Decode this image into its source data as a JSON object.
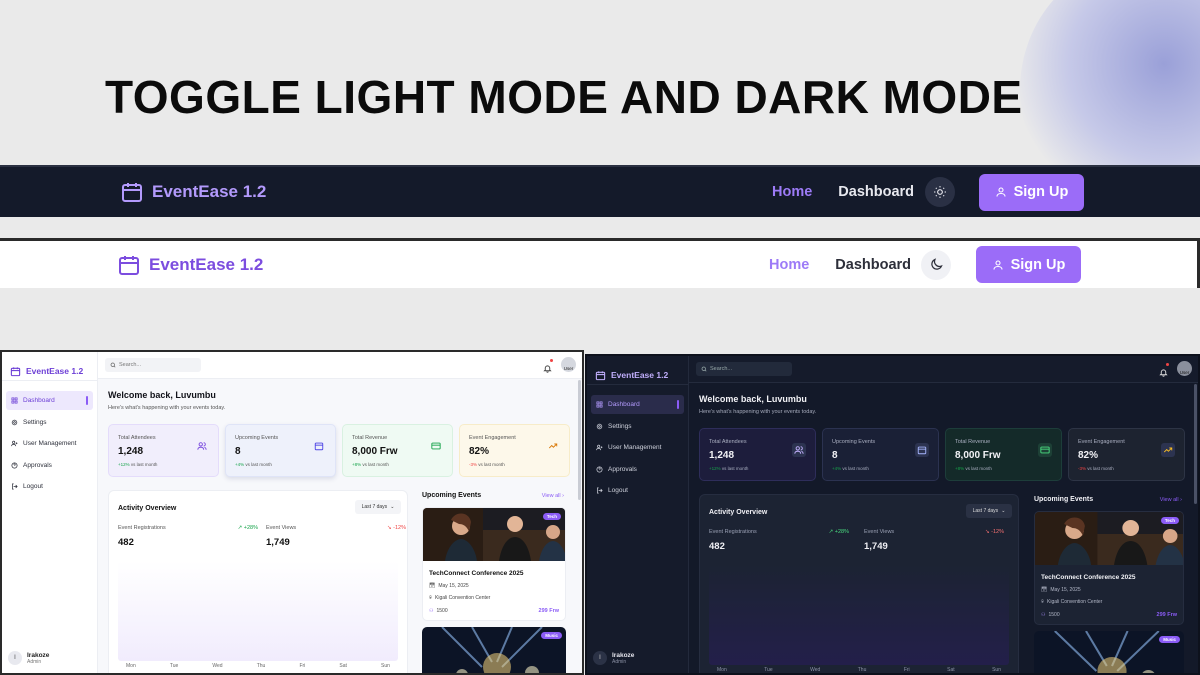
{
  "heading": "TOGGLE LIGHT MODE AND DARK MODE",
  "navbar": {
    "brand": "EventEase 1.2",
    "home": "Home",
    "dashboard": "Dashboard",
    "sign_up": "Sign Up",
    "dark_mode_icon": "sun-icon",
    "light_mode_icon": "moon-icon"
  },
  "dashboard": {
    "brand": "EventEase 1.2",
    "search_placeholder": "Search...",
    "user_avatar": "User",
    "menu": [
      {
        "label": "Dashboard",
        "icon": "grid-icon",
        "active": true
      },
      {
        "label": "Settings",
        "icon": "gear-icon"
      },
      {
        "label": "User Management",
        "icon": "user-plus-icon"
      },
      {
        "label": "Approvals",
        "icon": "question-circle-icon"
      },
      {
        "label": "Logout",
        "icon": "logout-icon"
      }
    ],
    "user": {
      "initial": "I",
      "name": "Irakoze",
      "role": "Admin"
    },
    "welcome": "Welcome back, Luvumbu",
    "subtitle": "Here's what's happening with your events today.",
    "stats": [
      {
        "label": "Total Attendees",
        "value": "1,248",
        "change": "+12%",
        "note": "vs last month",
        "trend": "up"
      },
      {
        "label": "Upcoming Events",
        "value": "8",
        "change": "+4%",
        "note": "vs last month",
        "trend": "up"
      },
      {
        "label": "Total Revenue",
        "value": "8,000 Frw",
        "change": "+8%",
        "note": "vs last month",
        "trend": "up"
      },
      {
        "label": "Event Engagement",
        "value": "82%",
        "change": "-3%",
        "note": "vs last month",
        "trend": "down"
      }
    ],
    "activity": {
      "title": "Activity Overview",
      "range": "Last 7 days",
      "registrations_label": "Event Registrations",
      "registrations_value": "482",
      "registrations_change": "+28%",
      "views_label": "Event Views",
      "views_value": "1,749",
      "views_change": "-12%",
      "days": [
        "Mon",
        "Tue",
        "Wed",
        "Thu",
        "Fri",
        "Sat",
        "Sun"
      ]
    },
    "upcoming": {
      "title": "Upcoming Events",
      "view_all": "View all",
      "event": {
        "tag": "Tech",
        "name": "TechConnect Conference 2025",
        "date": "May 15, 2025",
        "location": "Kigali Convention Center",
        "attendees": "1500",
        "price": "299 Frw"
      },
      "second_tag": "Music"
    }
  },
  "colors": {
    "accent": "#8b5cf6",
    "dark_bg": "#131929",
    "light_bg": "#f7f8fb"
  }
}
